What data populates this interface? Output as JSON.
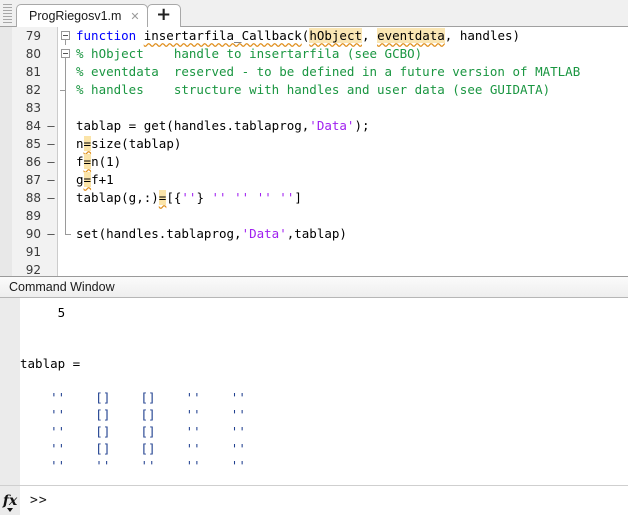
{
  "tabbar": {
    "tab_label": "ProgRiegosv1.m",
    "close_glyph": "✕",
    "new_tab_glyph": "+"
  },
  "editor": {
    "lines": [
      {
        "no": "79",
        "mark": "",
        "fold": "box",
        "segments": [
          {
            "t": "function ",
            "c": "kw"
          },
          {
            "t": "insertarfila_Callback",
            "c": "squig"
          },
          {
            "t": "(",
            "c": ""
          },
          {
            "t": "hObject",
            "c": "hl squig"
          },
          {
            "t": ", ",
            "c": ""
          },
          {
            "t": "eventdata",
            "c": "hl squig"
          },
          {
            "t": ", handles)",
            "c": ""
          }
        ]
      },
      {
        "no": "80",
        "mark": "",
        "fold": "box2",
        "segments": [
          {
            "t": "% hObject    handle to insertarfila (see GCBO)",
            "c": "cmt"
          }
        ]
      },
      {
        "no": "81",
        "mark": "",
        "fold": "line",
        "segments": [
          {
            "t": "% eventdata  reserved - to be defined in a future version of MATLAB",
            "c": "cmt"
          }
        ]
      },
      {
        "no": "82",
        "mark": "",
        "fold": "tick",
        "segments": [
          {
            "t": "% handles    structure with handles and user data (see GUIDATA)",
            "c": "cmt"
          }
        ]
      },
      {
        "no": "83",
        "mark": "",
        "fold": "line",
        "segments": []
      },
      {
        "no": "84",
        "mark": "–",
        "fold": "line",
        "segments": [
          {
            "t": "tablap = get(handles.tablaprog,",
            "c": ""
          },
          {
            "t": "'Data'",
            "c": "str"
          },
          {
            "t": ");",
            "c": ""
          }
        ]
      },
      {
        "no": "85",
        "mark": "–",
        "fold": "line",
        "segments": [
          {
            "t": "n",
            "c": ""
          },
          {
            "t": "=",
            "c": "eqwarn squig"
          },
          {
            "t": "size(tablap)",
            "c": ""
          }
        ]
      },
      {
        "no": "86",
        "mark": "–",
        "fold": "line",
        "segments": [
          {
            "t": "f",
            "c": ""
          },
          {
            "t": "=",
            "c": "eqwarn squig"
          },
          {
            "t": "n(1)",
            "c": ""
          }
        ]
      },
      {
        "no": "87",
        "mark": "–",
        "fold": "line",
        "segments": [
          {
            "t": "g",
            "c": ""
          },
          {
            "t": "=",
            "c": "eqwarn squig"
          },
          {
            "t": "f+1",
            "c": ""
          }
        ]
      },
      {
        "no": "88",
        "mark": "–",
        "fold": "line",
        "segments": [
          {
            "t": "tablap(g,:)",
            "c": ""
          },
          {
            "t": "=",
            "c": "eqwarn squig"
          },
          {
            "t": "[{",
            "c": ""
          },
          {
            "t": "''",
            "c": "str"
          },
          {
            "t": "} ",
            "c": ""
          },
          {
            "t": "''",
            "c": "str"
          },
          {
            "t": " ",
            "c": ""
          },
          {
            "t": "''",
            "c": "str"
          },
          {
            "t": " ",
            "c": ""
          },
          {
            "t": "''",
            "c": "str"
          },
          {
            "t": " ",
            "c": ""
          },
          {
            "t": "''",
            "c": "str"
          },
          {
            "t": "]",
            "c": ""
          }
        ]
      },
      {
        "no": "89",
        "mark": "",
        "fold": "line",
        "segments": []
      },
      {
        "no": "90",
        "mark": "–",
        "fold": "end",
        "segments": [
          {
            "t": "set(handles.tablaprog,",
            "c": ""
          },
          {
            "t": "'Data'",
            "c": "str"
          },
          {
            "t": ",tablap)",
            "c": ""
          }
        ]
      },
      {
        "no": "91",
        "mark": "",
        "fold": "",
        "segments": []
      },
      {
        "no": "92",
        "mark": "",
        "fold": "",
        "segments": []
      }
    ]
  },
  "command_window": {
    "title": "Command Window",
    "output_lines": [
      "     5",
      "",
      "",
      "tablap =",
      "",
      "    ''    []    []    ''    ''",
      "    ''    []    []    ''    ''",
      "    ''    []    []    ''    ''",
      "    ''    []    []    ''    ''",
      "    ''    ''    ''    ''    ''"
    ],
    "fx_label": "fx",
    "prompt": ">>"
  }
}
